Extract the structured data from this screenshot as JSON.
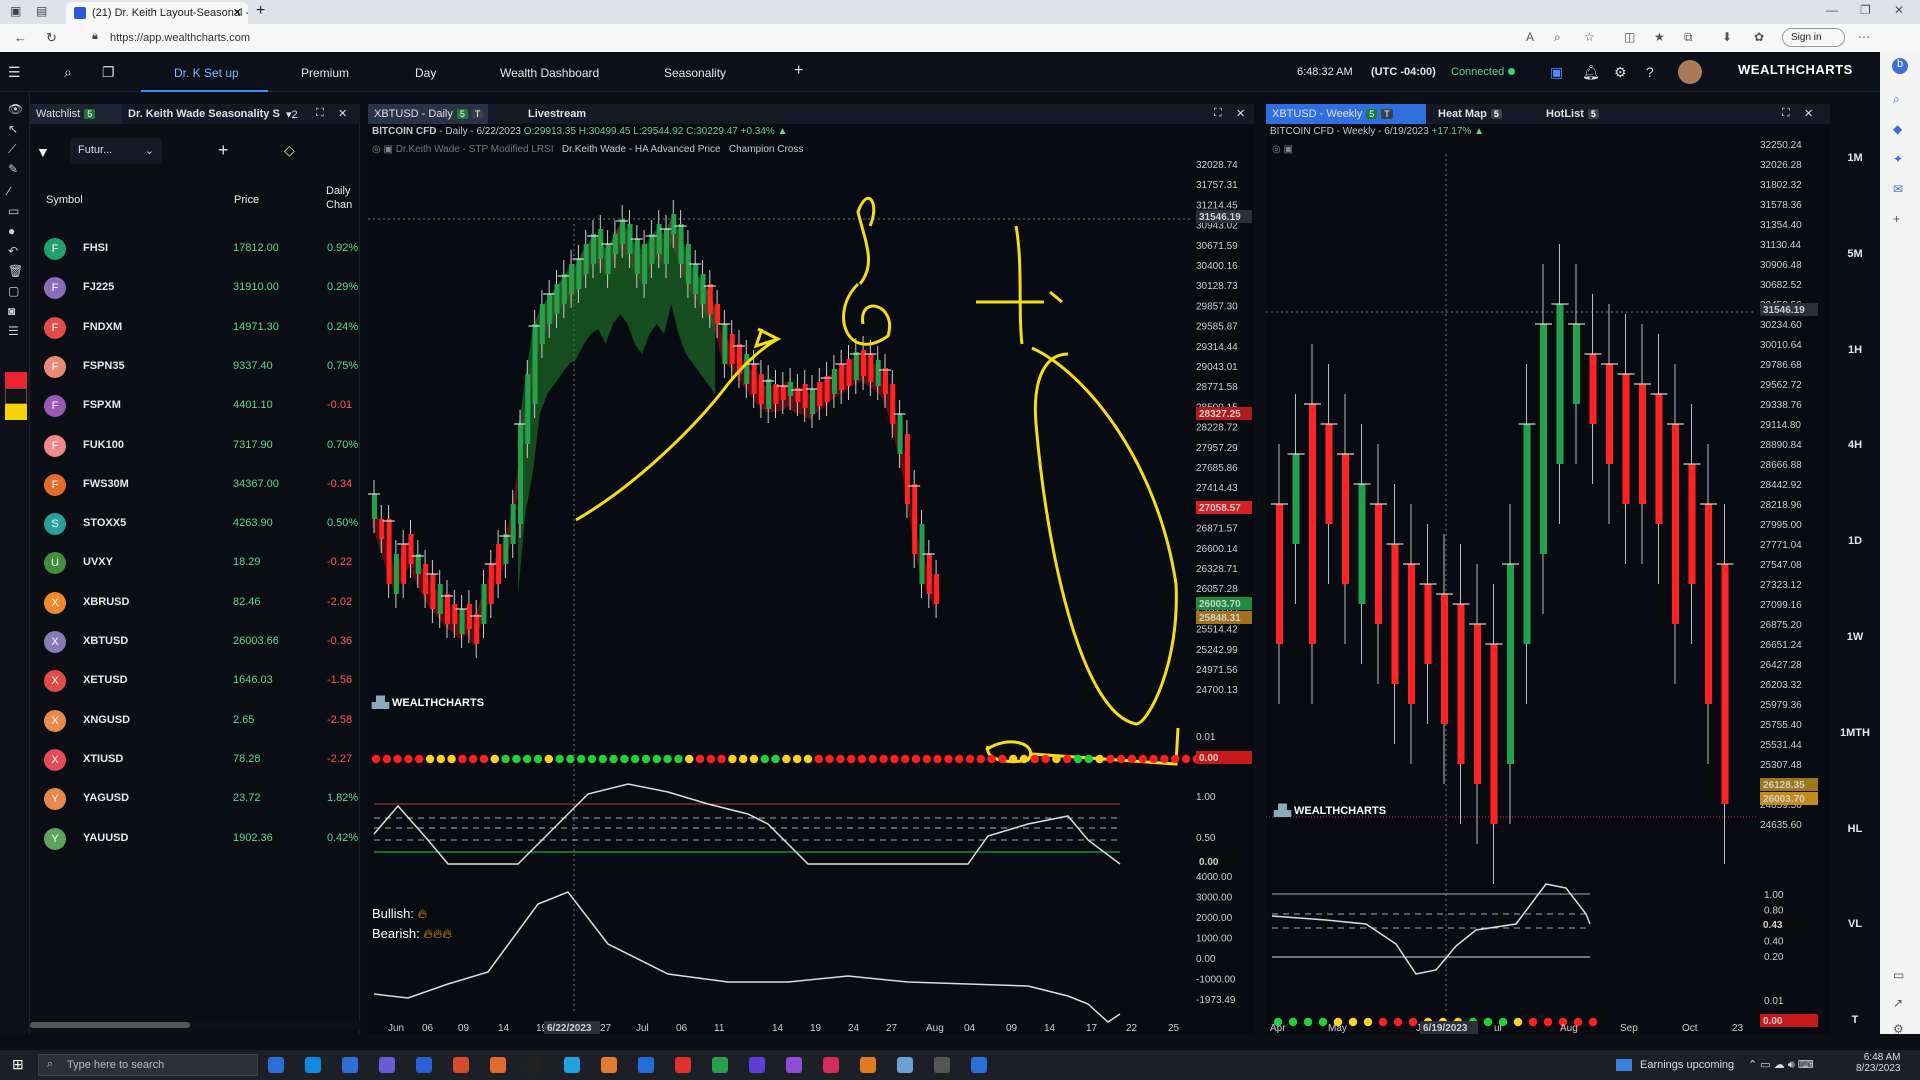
{
  "browser": {
    "tab_title": "(21) Dr. Keith Layout-Seasonal - ",
    "url": "https://app.wealthcharts.com",
    "signin": "Sign in"
  },
  "nav": {
    "tabs": [
      "Dr. K Set up",
      "Premium",
      "Day",
      "Wealth Dashboard",
      "Seasonality"
    ],
    "add": "+",
    "time": "6:48:32 AM",
    "tz": "(UTC -04:00)",
    "status": "Connected",
    "logo": "WEALTHCHARTS"
  },
  "watchlist": {
    "tab1": "Watchlist",
    "tab1_badge": "5",
    "tab2": "Dr. Keith Wade Seasonality S",
    "tab2_count": "2",
    "filter": "Futur...",
    "col_symbol": "Symbol",
    "col_price": "Price",
    "col_change": "Daily Chan",
    "rows": [
      {
        "l": "F",
        "s": "FHSI",
        "p": "17812.00",
        "c": "0.92%",
        "bg": "#22a06b"
      },
      {
        "l": "F",
        "s": "FJ225",
        "p": "31910.00",
        "c": "0.29%",
        "bg": "#8e6bb8"
      },
      {
        "l": "F",
        "s": "FNDXM",
        "p": "14971.30",
        "c": "0.24%",
        "bg": "#e04c4c"
      },
      {
        "l": "F",
        "s": "FSPN35",
        "p": "9337.40",
        "c": "0.75%",
        "bg": "#e98b73"
      },
      {
        "l": "F",
        "s": "FSPXM",
        "p": "4401.10",
        "c": "-0.01",
        "bg": "#9b59b6"
      },
      {
        "l": "F",
        "s": "FUK100",
        "p": "7317.90",
        "c": "0.70%",
        "bg": "#f08a8a"
      },
      {
        "l": "F",
        "s": "FWS30M",
        "p": "34367.00",
        "c": "-0.34",
        "bg": "#e36b2c"
      },
      {
        "l": "S",
        "s": "STOXX5",
        "p": "4263.90",
        "c": "0.50%",
        "bg": "#2aa198"
      },
      {
        "l": "U",
        "s": "UVXY",
        "p": "18.29",
        "c": "-0.22",
        "bg": "#3f8f3f"
      },
      {
        "l": "X",
        "s": "XBRUSD",
        "p": "82.46",
        "c": "-2.02",
        "bg": "#f0892b"
      },
      {
        "l": "X",
        "s": "XBTUSD",
        "p": "26003.66",
        "c": "-0.36",
        "bg": "#8a7ab8"
      },
      {
        "l": "X",
        "s": "XETUSD",
        "p": "1646.03",
        "c": "-1.56",
        "bg": "#e04c4c"
      },
      {
        "l": "X",
        "s": "XNGUSD",
        "p": "2.65",
        "c": "-2.58",
        "bg": "#e98b4a"
      },
      {
        "l": "X",
        "s": "XTIUSD",
        "p": "78.28",
        "c": "-2.27",
        "bg": "#e04c5a"
      },
      {
        "l": "Y",
        "s": "YAGUSD",
        "p": "23.72",
        "c": "1.82%",
        "bg": "#e8884a"
      },
      {
        "l": "Y",
        "s": "YAUUSD",
        "p": "1902.36",
        "c": "0.42%",
        "bg": "#5fa35f"
      }
    ]
  },
  "daily": {
    "tab": "XBTUSD - Daily",
    "tab_badge": "5",
    "tab_t": "T",
    "tab2": "Livestream",
    "info_name": "BITCOIN CFD",
    "info_tf": "- Daily - 6/22/2023",
    "info_o": "O:29913.35",
    "info_h": "H:30499.45",
    "info_l": "L:29544.92",
    "info_c": "C:30229.47",
    "info_pct": "+0.34%",
    "ind1": "Dr.Keith Wade - STP Modified LRSI",
    "ind2": "Dr.Keith Wade - HA Advanced Price",
    "ind3": "Champion Cross",
    "watermark": "WEALTHCHARTS",
    "bull": "Bullish:",
    "bear": "Bearish:",
    "crosshair_price": "31546.19",
    "tag_red1": "28327.25",
    "tag_red2": "27058.57",
    "tag_green": "26003.70",
    "tag_orange": "25848.31",
    "tag_zero": "0.00",
    "osc_zero": "0.00",
    "date_tag": "6/22/2023",
    "price_ticks": [
      "32028.74",
      "31757.31",
      "31214.45",
      "30943.02",
      "30671.59",
      "30400.16",
      "30128.73",
      "29857.30",
      "29585.87",
      "29314.44",
      "29043.01",
      "28771.58",
      "28500.15",
      "28228.72",
      "27957.29",
      "27685.86",
      "27414.43",
      "27143.00",
      "26871.57",
      "26600.14",
      "26328.71",
      "26057.28",
      "25785.85",
      "25514.42",
      "25242.99",
      "24971.56",
      "24700.13"
    ],
    "dot_axis": "0.01",
    "osc_ticks": [
      "1.00",
      "0.50"
    ],
    "osc2_ticks": [
      "4000.00",
      "3000.00",
      "2000.00",
      "1000.00",
      "0.00",
      "-1000.00",
      "-1973.49"
    ],
    "xlabels": [
      "Jun",
      "06",
      "09",
      "14",
      "19",
      "27",
      "Jul",
      "06",
      "11",
      "14",
      "19",
      "24",
      "27",
      "Aug",
      "04",
      "09",
      "14",
      "17",
      "22",
      "25"
    ]
  },
  "weekly": {
    "tab": "XBTUSD - Weekly",
    "tab_badge": "5",
    "tab_t": "T",
    "tab2": "Heat Map",
    "tab2_badge": "5",
    "tab3": "HotList",
    "tab3_badge": "5",
    "info": "BITCOIN CFD - Weekly - 6/19/2023",
    "info_pct": "+17.17%",
    "watermark": "WEALTHCHARTS",
    "crosshair_price": "31546.19",
    "tag1": "26128.35",
    "tag2": "26003.70",
    "tag_osc": "0.43",
    "tag_zero": "0.00",
    "date_tag": "6/19/2023",
    "price_ticks": [
      "32250.24",
      "32026.28",
      "31802.32",
      "31578.36",
      "31354.40",
      "31130.44",
      "30906.48",
      "30682.52",
      "30458.56",
      "30234.60",
      "30010.64",
      "29786.68",
      "29562.72",
      "29338.76",
      "29114.80",
      "28890.84",
      "28666.88",
      "28442.92",
      "28218.96",
      "27995.00",
      "27771.04",
      "27547.08",
      "27323.12",
      "27099.16",
      "26875.20",
      "26651.24",
      "26427.28",
      "26203.32",
      "25979.36",
      "25755.40",
      "25531.44",
      "25307.48",
      "25083.52",
      "24859.56",
      "24635.60"
    ],
    "osc_ticks": [
      "1.00",
      "0.80",
      "0.60",
      "0.40",
      "0.20"
    ],
    "dot_axis": "0.01",
    "xlabels": [
      "Apr",
      "May",
      "Ju",
      "ul",
      "Aug",
      "Sep",
      "Oct",
      "23"
    ]
  },
  "timeframes": [
    "1M",
    "5M",
    "1H",
    "4H",
    "1D",
    "1W",
    "1MTH",
    "HL",
    "VL",
    "T"
  ],
  "taskbar": {
    "search": "Type here to search",
    "news": "Earnings upcoming",
    "clock1": "6:48 AM",
    "clock2": "8/23/2023"
  }
}
